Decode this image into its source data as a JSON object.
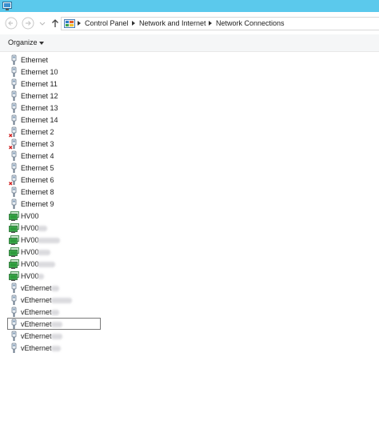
{
  "window": {
    "icon": "network-connections-window-icon"
  },
  "nav": {
    "back_icon": "back-arrow-icon",
    "forward_icon": "forward-arrow-icon",
    "history_icon": "recent-locations-chevron-icon",
    "up_icon": "up-arrow-icon"
  },
  "breadcrumb": {
    "icon": "control-panel-icon",
    "items": [
      "Control Panel",
      "Network and Internet",
      "Network Connections"
    ]
  },
  "toolbar": {
    "organize_label": "Organize"
  },
  "connections": [
    {
      "name": "Ethernet",
      "icon": "ethernet-adapter-icon",
      "status": "connected"
    },
    {
      "name": "Ethernet 10",
      "icon": "ethernet-adapter-icon",
      "status": "connected"
    },
    {
      "name": "Ethernet 11",
      "icon": "ethernet-adapter-icon",
      "status": "connected"
    },
    {
      "name": "Ethernet 12",
      "icon": "ethernet-adapter-icon",
      "status": "connected"
    },
    {
      "name": "Ethernet 13",
      "icon": "ethernet-adapter-icon",
      "status": "connected"
    },
    {
      "name": "Ethernet 14",
      "icon": "ethernet-adapter-icon",
      "status": "connected"
    },
    {
      "name": "Ethernet 2",
      "icon": "ethernet-adapter-disconnected-icon",
      "status": "disconnected"
    },
    {
      "name": "Ethernet 3",
      "icon": "ethernet-adapter-disconnected-icon",
      "status": "disconnected"
    },
    {
      "name": "Ethernet 4",
      "icon": "ethernet-adapter-icon",
      "status": "connected"
    },
    {
      "name": "Ethernet 5",
      "icon": "ethernet-adapter-icon",
      "status": "connected"
    },
    {
      "name": "Ethernet 6",
      "icon": "ethernet-adapter-disconnected-icon",
      "status": "disconnected"
    },
    {
      "name": "Ethernet 8",
      "icon": "ethernet-adapter-icon",
      "status": "connected"
    },
    {
      "name": "Ethernet 9",
      "icon": "ethernet-adapter-icon",
      "status": "connected"
    },
    {
      "name": "HV00",
      "icon": "team-adapter-icon",
      "status": "connected"
    },
    {
      "name": "HV00",
      "icon": "team-adapter-icon",
      "status": "connected",
      "redacted": true
    },
    {
      "name": "HV00",
      "icon": "team-adapter-icon",
      "status": "connected",
      "redacted": true
    },
    {
      "name": "HV00",
      "icon": "team-adapter-icon",
      "status": "connected",
      "redacted": true
    },
    {
      "name": "HV00",
      "icon": "team-adapter-icon",
      "status": "connected",
      "redacted": true
    },
    {
      "name": "HV00",
      "icon": "team-adapter-icon",
      "status": "connected",
      "redacted": true
    },
    {
      "name": "vEthernet",
      "icon": "ethernet-adapter-icon",
      "status": "connected",
      "redacted": true
    },
    {
      "name": "vEthernet",
      "icon": "ethernet-adapter-icon",
      "status": "connected",
      "redacted": true
    },
    {
      "name": "vEthernet",
      "icon": "ethernet-adapter-icon",
      "status": "connected",
      "redacted": true
    },
    {
      "name": "vEthernet",
      "icon": "ethernet-adapter-icon",
      "status": "connected",
      "redacted": true,
      "selected": true
    },
    {
      "name": "vEthernet",
      "icon": "ethernet-adapter-icon",
      "status": "connected",
      "redacted": true
    },
    {
      "name": "vEthernet",
      "icon": "ethernet-adapter-icon",
      "status": "connected",
      "redacted": true
    }
  ],
  "colors": {
    "titlebar": "#5bc9ec",
    "commandbar": "#f5f6f7",
    "adapter_green": "#2e9a3c",
    "error_red": "#d02020"
  }
}
